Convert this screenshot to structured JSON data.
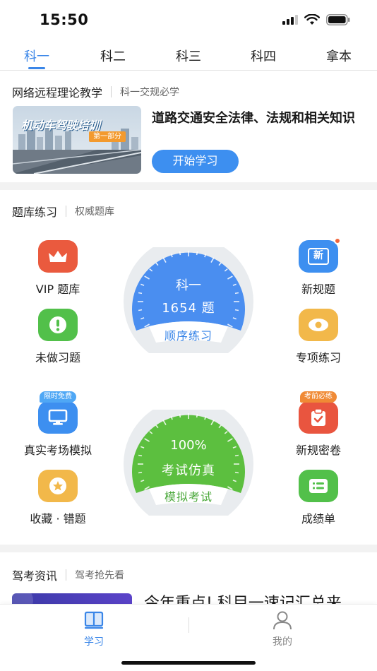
{
  "status_bar": {
    "time": "15:50"
  },
  "tabs": [
    {
      "label": "科一",
      "active": true
    },
    {
      "label": "科二",
      "active": false
    },
    {
      "label": "科三",
      "active": false
    },
    {
      "label": "科四",
      "active": false
    },
    {
      "label": "拿本",
      "active": false
    }
  ],
  "online_section": {
    "title": "网络远程理论教学",
    "subtitle": "科一交规必学",
    "banner": {
      "main_text": "机动车驾驶培训",
      "badge": "第一部分"
    },
    "course_title": "道路交通安全法律、法规和相关知识",
    "start_button": "开始学习"
  },
  "practice_section": {
    "title": "题库练习",
    "subtitle": "权威题库",
    "features": {
      "vip": {
        "label": "VIP 题库",
        "icon": "crown-icon"
      },
      "new_rules": {
        "label": "新规题",
        "icon": "new-badge-icon",
        "icon_text": "新"
      },
      "undone": {
        "label": "未做习题",
        "icon": "exclamation-icon"
      },
      "special": {
        "label": "专项练习",
        "icon": "eye-icon"
      },
      "real_exam": {
        "label": "真实考场模拟",
        "icon": "monitor-icon",
        "tag": "限时免费"
      },
      "secret": {
        "label": "新规密卷",
        "icon": "clipboard-check-icon",
        "tag": "考前必练"
      },
      "favorites": {
        "label": "收藏 · 错题",
        "icon": "star-icon"
      },
      "report": {
        "label": "成绩单",
        "icon": "list-icon"
      }
    },
    "sequential_dial": {
      "line1": "科一",
      "line2": "1654 题",
      "label": "顺序练习"
    },
    "exam_dial": {
      "line1": "100%",
      "line2": "考试仿真",
      "label": "模拟考试"
    }
  },
  "news_section": {
    "title": "驾考资讯",
    "subtitle": "驾考抢先看",
    "article_title": "今年重点! 科目一速记汇总来"
  },
  "bottom_nav": [
    {
      "label": "学习",
      "icon": "book-icon",
      "active": true
    },
    {
      "label": "我的",
      "icon": "person-icon",
      "active": false
    }
  ],
  "colors": {
    "accent": "#3a86e8",
    "dial_blue": "#4a8ef0",
    "dial_green": "#5cbf3f",
    "vip": "#ea5a3e",
    "warn_green": "#52c04a",
    "yellow": "#f2b84a",
    "red": "#e9553f"
  }
}
